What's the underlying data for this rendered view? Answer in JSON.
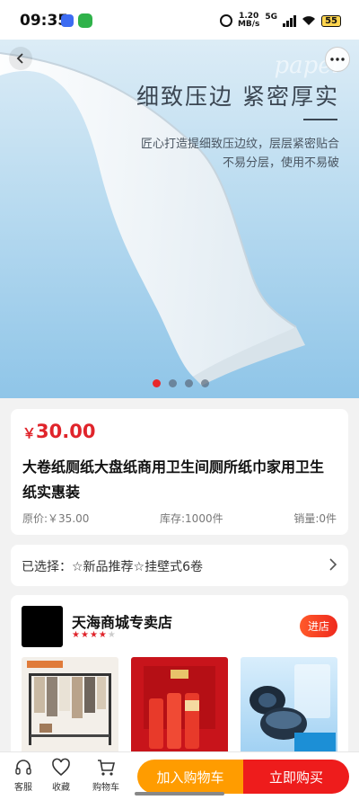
{
  "status_bar": {
    "time": "09:35",
    "net_speed_value": "1.20",
    "net_speed_unit": "MB/s",
    "network": "5G",
    "battery": "55"
  },
  "hero": {
    "brand_text": "papel",
    "title": "细致压边 紧密厚实",
    "subtitle_line1": "匠心打造提细致压边纹，层层紧密贴合",
    "subtitle_line2": "不易分层，使用不易破",
    "slide_count": 4,
    "active_slide": 1
  },
  "product": {
    "currency": "￥",
    "price": "30.00",
    "title": "大卷纸厕纸大盘纸商用卫生间厕所纸巾家用卫生纸实惠装",
    "original_price": "原价:￥35.00",
    "stock": "库存:1000件",
    "sales": "销量:0件"
  },
  "selection": {
    "label": "已选择：☆新品推荐☆挂壁式6卷"
  },
  "shop": {
    "name": "天海商城专卖店",
    "rating_stars": 4,
    "rating_max": 5,
    "enter_label": "进店"
  },
  "bottom_bar": {
    "service_label": "客服",
    "favorite_label": "收藏",
    "cart_label": "购物车",
    "add_to_cart_label": "加入购物车",
    "buy_now_label": "立即购买"
  },
  "colors": {
    "price_red": "#e0242b",
    "cart_orange": "#ff9c00",
    "buy_red": "#ee1c1c"
  }
}
